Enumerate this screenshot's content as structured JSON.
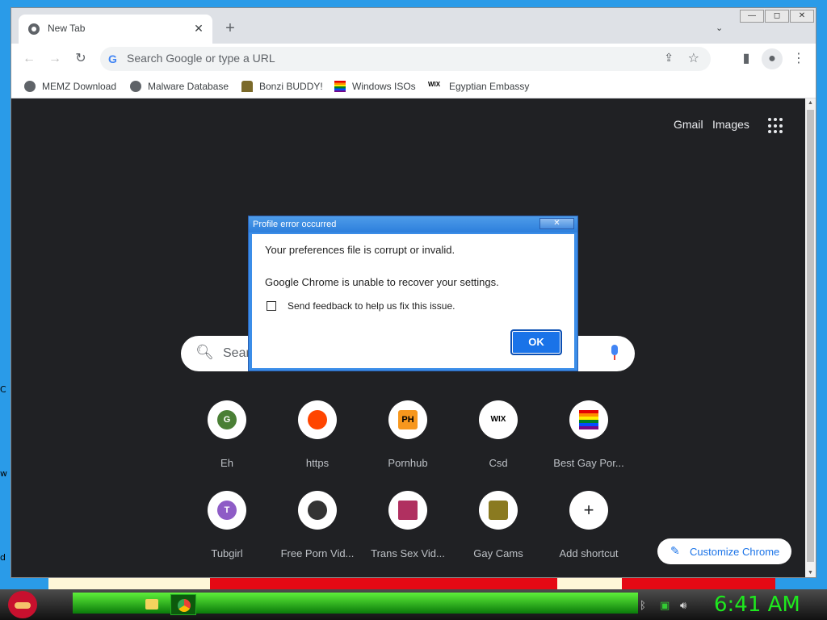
{
  "desktop": {
    "edge_letters": [
      "C",
      "w",
      "d"
    ]
  },
  "window": {
    "tab": {
      "title": "New Tab",
      "close": "✕"
    },
    "new_tab": "+",
    "tab_search": "⌄",
    "controls": {
      "minimize": "—",
      "maximize": "◻",
      "close": "✕"
    }
  },
  "toolbar": {
    "back": "←",
    "forward": "→",
    "reload": "↻",
    "omnibox_placeholder": "Search Google or type a URL",
    "share": "⇪",
    "star": "☆",
    "side_panel": "▮",
    "profile": "●",
    "menu": "⋮"
  },
  "bookmarks": [
    {
      "label": "MEMZ Download",
      "icon": "globe-icon"
    },
    {
      "label": "Malware Database",
      "icon": "globe-icon"
    },
    {
      "label": "Bonzi BUDDY!",
      "icon": "bonzi-icon"
    },
    {
      "label": "Windows ISOs",
      "icon": "rainbow-flag-icon"
    },
    {
      "label": "Egyptian Embassy",
      "icon": "wix-icon",
      "icon_text": "WIX"
    }
  ],
  "ntp": {
    "gmail": "Gmail",
    "images": "Images",
    "search_placeholder": "Sear",
    "customize": "Customize Chrome",
    "shortcuts_row1": [
      {
        "label": "Eh",
        "icon_text": "G",
        "color": "#4a7f35"
      },
      {
        "label": "https",
        "icon_text": "",
        "color": "#ff4500"
      },
      {
        "label": "Pornhub",
        "icon_text": "PH",
        "color": "#f7971d"
      },
      {
        "label": "Csd",
        "icon_text": "WIX",
        "color": "#ffffff"
      },
      {
        "label": "Best Gay Por...",
        "icon_text": "",
        "color": "rainbow"
      }
    ],
    "shortcuts_row2": [
      {
        "label": "Tubgirl",
        "icon_text": "T",
        "color": "#8e5cc6"
      },
      {
        "label": "Free Porn Vid...",
        "icon_text": "",
        "color": "#333333"
      },
      {
        "label": "Trans Sex Vid...",
        "icon_text": "",
        "color": "#b03060"
      },
      {
        "label": "Gay Cams",
        "icon_text": "",
        "color": "#8a7a20"
      },
      {
        "label": "Add shortcut",
        "icon_text": "+",
        "color": "#ffffff"
      }
    ]
  },
  "dialog": {
    "title": "Profile error occurred",
    "close": "✕",
    "message1": "Your preferences file is corrupt or invalid.",
    "message2": "Google Chrome is unable to recover your settings.",
    "checkbox_label": "Send feedback to help us fix this issue.",
    "ok_label": "OK"
  },
  "taskbar": {
    "clock": "6:41 AM",
    "tray_icons": [
      "bluetooth-icon",
      "network-icon",
      "volume-icon"
    ]
  }
}
